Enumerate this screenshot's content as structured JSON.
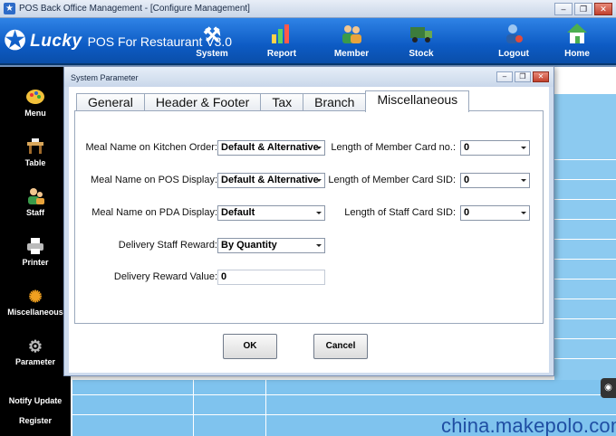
{
  "window": {
    "title": "POS Back Office Management - [Configure Management]",
    "controls": {
      "minimize": "–",
      "restore": "❐",
      "close": "✕"
    }
  },
  "brand": {
    "name": "Lucky",
    "subtitle": "POS For Restaurant V3.0"
  },
  "toolbar": {
    "items": [
      {
        "label": "System",
        "icon": "tools-icon"
      },
      {
        "label": "Report",
        "icon": "bar-chart-icon"
      },
      {
        "label": "Member",
        "icon": "people-icon"
      },
      {
        "label": "Stock",
        "icon": "truck-icon"
      },
      {
        "label": "Logout",
        "icon": "user-logout-icon"
      },
      {
        "label": "Home",
        "icon": "home-icon"
      }
    ]
  },
  "sidebar": {
    "items": [
      {
        "label": "Menu",
        "icon": "palette-icon"
      },
      {
        "label": "Table",
        "icon": "table-icon"
      },
      {
        "label": "Staff",
        "icon": "staff-icon"
      },
      {
        "label": "Printer",
        "icon": "printer-icon"
      },
      {
        "label": "Miscellaneous",
        "icon": "gear-flower-icon"
      },
      {
        "label": "Parameter",
        "icon": "gear-icon"
      }
    ],
    "links": [
      "Notify Update",
      "Register"
    ]
  },
  "dialog": {
    "title": "System Parameter",
    "tabs": [
      "General",
      "Header & Footer",
      "Tax",
      "Branch",
      "Miscellaneous"
    ],
    "active_tab": "Miscellaneous",
    "fields_left": [
      {
        "label": "Meal Name on Kitchen Order:",
        "value": "Default & Alternative",
        "kind": "select"
      },
      {
        "label": "Meal Name on POS Display:",
        "value": "Default & Alternative",
        "kind": "select"
      },
      {
        "label": "Meal Name on PDA Display:",
        "value": "Default",
        "kind": "select"
      },
      {
        "label": "Delivery Staff Reward:",
        "value": "By Quantity",
        "kind": "select"
      },
      {
        "label": "Delivery Reward Value:",
        "value": "0",
        "kind": "text"
      }
    ],
    "fields_right": [
      {
        "label": "Length of Member Card no.:",
        "value": "0",
        "kind": "select"
      },
      {
        "label": "Length of Member Card SID:",
        "value": "0",
        "kind": "select"
      },
      {
        "label": "Length of Staff Card SID:",
        "value": "0",
        "kind": "select"
      }
    ],
    "ok_label": "OK",
    "cancel_label": "Cancel"
  },
  "watermark": "china.makepolo.com",
  "colors": {
    "toolbar": "#0d5bc4",
    "sidebar": "#000000",
    "grid": "#7fc3ee",
    "dialog": "#cfdcee"
  }
}
